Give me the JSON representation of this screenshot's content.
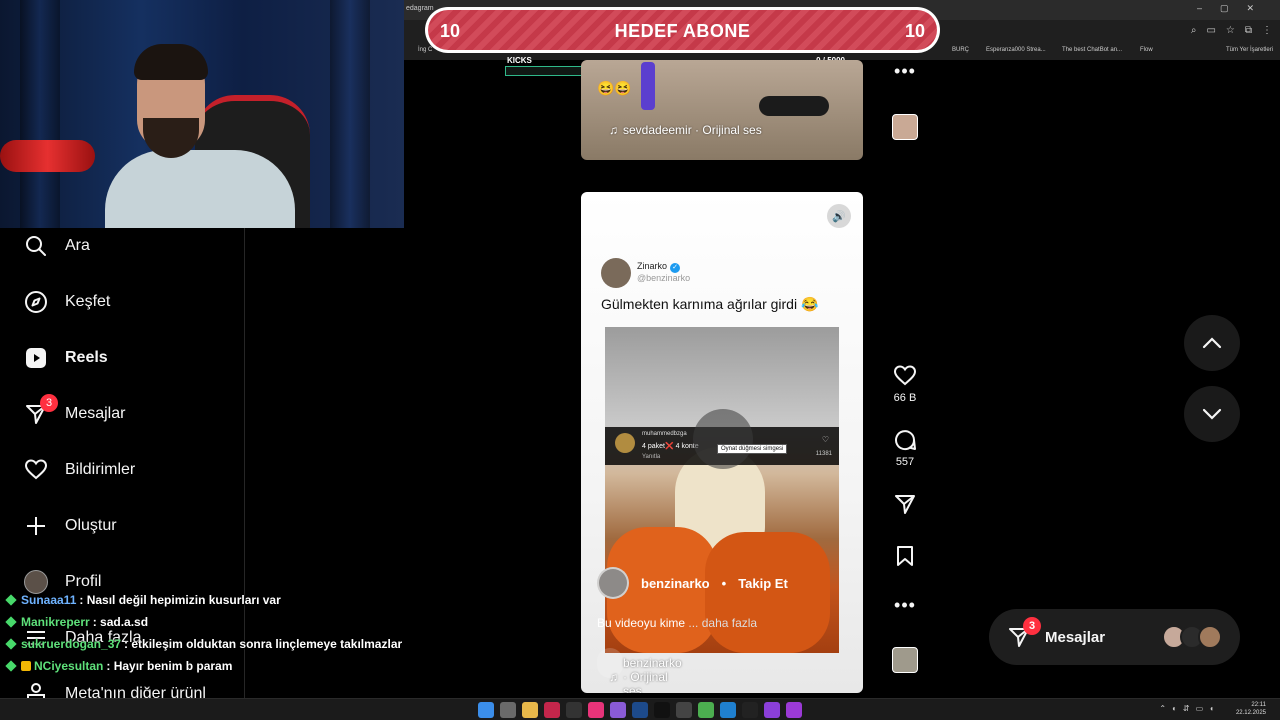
{
  "browser": {
    "tab_fragment": "edagram",
    "bookmarks": [
      "İng C",
      "BURÇ",
      "Esperanza000 Strea...",
      "The best ChatBot an...",
      "Flow",
      "Tüm Yer İşaretleri"
    ]
  },
  "goal": {
    "left_count": "10",
    "title": "HEDEF ABONE",
    "right_count": "10"
  },
  "kicks": {
    "label": "KICKS",
    "count": "0 / 5000",
    "progress_fraction": 0
  },
  "sidebar": {
    "items": [
      {
        "label": "Ara",
        "icon": "search-icon"
      },
      {
        "label": "Keşfet",
        "icon": "compass-icon"
      },
      {
        "label": "Reels",
        "icon": "reels-icon"
      },
      {
        "label": "Mesajlar",
        "icon": "messenger-icon",
        "badge": "3"
      },
      {
        "label": "Bildirimler",
        "icon": "heart-icon"
      },
      {
        "label": "Oluştur",
        "icon": "plus-icon"
      },
      {
        "label": "Profil",
        "icon": "avatar"
      },
      {
        "label": "Daha fazla",
        "icon": "menu-icon"
      },
      {
        "label": "Meta'nın diğer ürünl",
        "icon": "meta-icon"
      }
    ]
  },
  "chat": [
    {
      "user": "Sunaaa11",
      "message": ": Nasıl değil hepimizin kusurları var"
    },
    {
      "user": "Manikreperr",
      "message": ": sad.a.sd"
    },
    {
      "user": "sukruerdogan_37",
      "message": ": etkileşim olduktan sonra linçlemeye takılmazlar"
    },
    {
      "user": "NCiyesultan",
      "message": ": Hayır benim b param"
    }
  ],
  "reel_top": {
    "emoji": "😆😆",
    "audio": "sevdadeemir · Orijinal ses"
  },
  "reel_main": {
    "tweet_name": "Zinarko",
    "tweet_handle": "@benzinarko",
    "tweet_text": "Gülmekten karnıma ağrılar girdi 😂",
    "comment_user": "muhammedbzga",
    "comment_text": "4 paket❌ 4 konte",
    "comment_reply": "Yanıtla",
    "comment_likes": "11381",
    "tooltip": "Oynat düğmesi simgesi",
    "author": "benzinarko",
    "follow_label": "Takip Et",
    "caption": "Bu videoyu kime",
    "caption_more": "... daha fazla",
    "audio": "benzinarko · Orijinal ses"
  },
  "actions": {
    "likes": "66 B",
    "comments": "557"
  },
  "messages_pill": {
    "label": "Mesajlar",
    "badge": "3"
  },
  "taskbar": {
    "time": "22:11",
    "date": "22.12.2025"
  },
  "colors": {
    "goal_stripe": "#d24b5a",
    "kicks_bar": "#2fb98a",
    "badge": "#ff3040",
    "chat_user_blue": "#6fb3ff",
    "chat_user_green": "#5ee07a"
  }
}
